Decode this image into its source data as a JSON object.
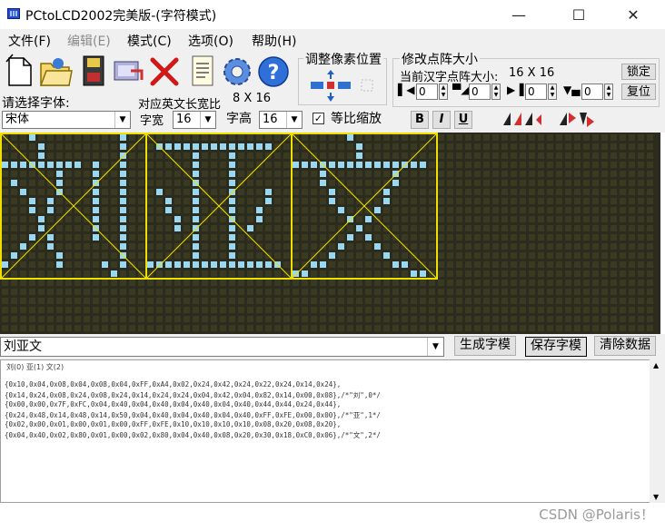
{
  "window": {
    "title": "PCtoLCD2002完美版-(字符模式)",
    "minimize_glyph": "—",
    "maximize_glyph": "☐",
    "close_glyph": "✕"
  },
  "menu": {
    "items": [
      {
        "label": "文件(F)",
        "enabled": true
      },
      {
        "label": "编辑(E)",
        "enabled": false
      },
      {
        "label": "模式(C)",
        "enabled": true
      },
      {
        "label": "选项(O)",
        "enabled": true
      },
      {
        "label": "帮助(H)",
        "enabled": true
      }
    ]
  },
  "toolbar": {
    "icons": [
      "new-file-icon",
      "open-folder-icon",
      "save-disk-icon",
      "export-icon",
      "delete-x-icon",
      "notepad-icon",
      "settings-gear-icon",
      "help-question-icon"
    ]
  },
  "pixel_adjust": {
    "title": "调整像素位置"
  },
  "resize": {
    "title": "修改点阵大小",
    "current_label": "当前汉字点阵大小:",
    "current_size": "16 X 16",
    "lock_label": "锁定",
    "reset_label": "复位",
    "spinners": [
      "0",
      "0",
      "0",
      "0"
    ]
  },
  "font": {
    "choose_label": "请选择字体:",
    "font_value": "宋体",
    "ascii_ratio_label": "对应英文长宽比",
    "ascii_ratio_value": "8 X 16",
    "width_label": "字宽",
    "width_value": "16",
    "height_label": "字高",
    "height_value": "16",
    "proportional_label": "等比缩放",
    "proportional_checked": true,
    "bold": "B",
    "italic": "I",
    "underline": "U"
  },
  "input": {
    "text": "刘亚文"
  },
  "actions": {
    "generate": "生成字模",
    "save": "保存字模",
    "clear": "清除数据"
  },
  "output": {
    "tabs": "刘(0) 亚(1) 文(2)",
    "lines": [
      "{0x10,0x04,0x08,0x04,0x08,0x04,0xFF,0xA4,0x02,0x24,0x42,0x24,0x22,0x24,0x14,0x24},",
      "{0x14,0x24,0x08,0x24,0x08,0x24,0x14,0x24,0x24,0x04,0x42,0x04,0x82,0x14,0x00,0x08},/*\"刘\",0*/",
      "{0x00,0x00,0x7F,0xFC,0x04,0x40,0x04,0x40,0x04,0x40,0x04,0x40,0x44,0x44,0x24,0x44},",
      "{0x24,0x48,0x14,0x48,0x14,0x50,0x04,0x40,0x04,0x40,0x04,0x40,0xFF,0xFE,0x00,0x00},/*\"亚\",1*/",
      "{0x02,0x00,0x01,0x00,0x01,0x00,0xFF,0xFE,0x10,0x10,0x10,0x10,0x08,0x20,0x08,0x20},",
      "{0x04,0x40,0x02,0x80,0x01,0x00,0x02,0x80,0x04,0x40,0x08,0x20,0x30,0x18,0xC0,0x06},/*\"文\",2*/"
    ]
  },
  "watermark": "CSDN @Polaris！",
  "colors": {
    "grid_bg": "#2c2c1e",
    "cell_off": "#3a3a22",
    "cell_on": "#9ad7f0",
    "frame": "#f0e000"
  }
}
